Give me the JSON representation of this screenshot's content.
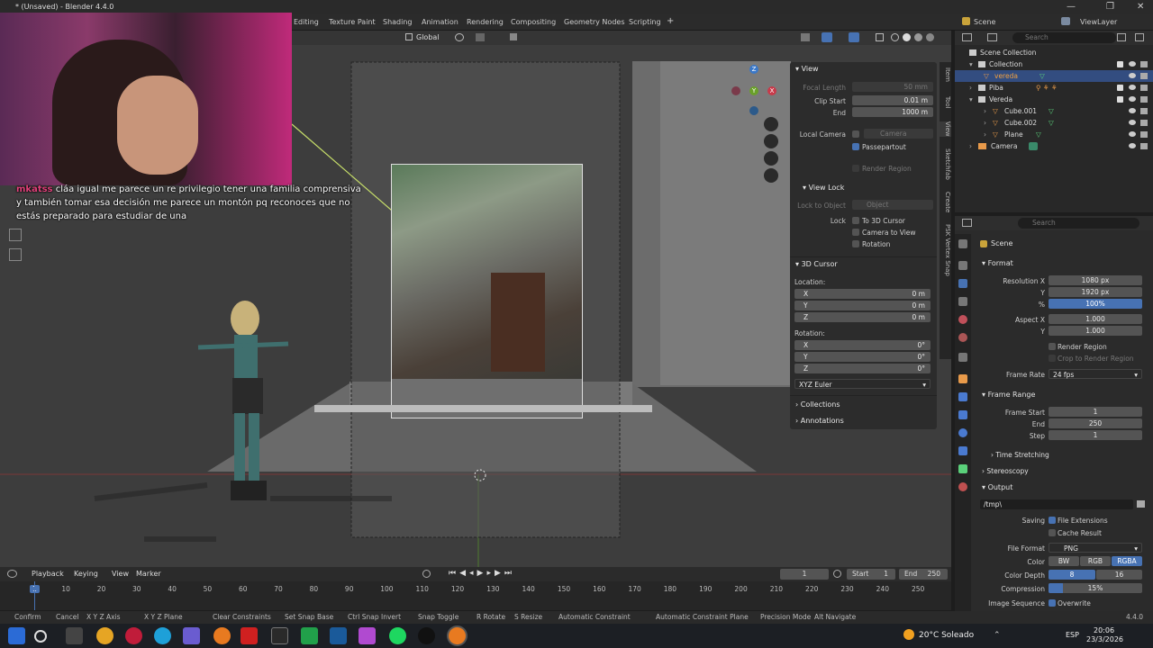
{
  "window": {
    "title": "* (Unsaved) - Blender 4.4.0",
    "min": "—",
    "max": "❐",
    "close": "✕"
  },
  "workspaces": [
    "Editing",
    "Texture Paint",
    "Shading",
    "Animation",
    "Rendering",
    "Compositing",
    "Geometry Nodes",
    "Scripting",
    "+"
  ],
  "top_right": {
    "scene": "Scene",
    "view_layer": "ViewLayer"
  },
  "viewport_header": {
    "orientation": "Global"
  },
  "chat_overlay": {
    "user": "mkatss",
    "message": "cláa igual me parece un re privilegio tener una familia comprensiva y también tomar esa decisión me parece un montón pq reconoces que no estás preparado para estudiar de una"
  },
  "gizmo": {
    "z": "Z",
    "y": "Y",
    "x": "X"
  },
  "npanel": {
    "view_header": "View",
    "focal_length_label": "Focal Length",
    "focal_length": "50 mm",
    "clip_start_label": "Clip Start",
    "clip_start": "0.01 m",
    "clip_end_label": "End",
    "clip_end": "1000 m",
    "local_camera_label": "Local Camera",
    "local_camera": "Camera",
    "passepartout": "Passepartout",
    "render_region": "Render Region",
    "view_lock_header": "View Lock",
    "lock_to_object_label": "Lock to Object",
    "lock_to_object": "Object",
    "lock_label": "Lock",
    "to_3d_cursor": "To 3D Cursor",
    "camera_to_view": "Camera to View",
    "rotation_lock": "Rotation",
    "cursor_header": "3D Cursor",
    "location_label": "Location:",
    "loc": [
      {
        "axis": "X",
        "value": "0 m"
      },
      {
        "axis": "Y",
        "value": "0 m"
      },
      {
        "axis": "Z",
        "value": "0 m"
      }
    ],
    "rotation_label": "Rotation:",
    "rot": [
      {
        "axis": "X",
        "value": "0°"
      },
      {
        "axis": "Y",
        "value": "0°"
      },
      {
        "axis": "Z",
        "value": "0°"
      }
    ],
    "rotation_mode": "XYZ Euler",
    "collections": "Collections",
    "annotations": "Annotations"
  },
  "vtabs": [
    "Item",
    "Tool",
    "View",
    "Sketchfab",
    "Create",
    "PSK Vertex Snap"
  ],
  "outliner": {
    "search_placeholder": "Search",
    "rows": [
      {
        "label": "Scene Collection"
      },
      {
        "label": "Collection"
      },
      {
        "label": "vereda"
      },
      {
        "label": "Piba"
      },
      {
        "label": "Vereda"
      },
      {
        "label": "Cube.001"
      },
      {
        "label": "Cube.002"
      },
      {
        "label": "Plane"
      },
      {
        "label": "Camera"
      }
    ]
  },
  "properties": {
    "search_placeholder": "Search",
    "scene_label": "Scene",
    "format_header": "Format",
    "res_x_label": "Resolution X",
    "res_x": "1080 px",
    "res_y_label": "Y",
    "res_y": "1920 px",
    "res_pct_label": "%",
    "res_pct": "100%",
    "aspect_x_label": "Aspect X",
    "aspect_x": "1.000",
    "aspect_y_label": "Y",
    "aspect_y": "1.000",
    "render_region": "Render Region",
    "crop": "Crop to Render Region",
    "frame_rate_label": "Frame Rate",
    "frame_rate": "24 fps",
    "frame_range_header": "Frame Range",
    "frame_start_label": "Frame Start",
    "frame_start": "1",
    "frame_end_label": "End",
    "frame_end": "250",
    "step_label": "Step",
    "step": "1",
    "time_stretching": "Time Stretching",
    "stereoscopy": "Stereoscopy",
    "output_header": "Output",
    "output_path": "/tmp\\",
    "saving_label": "Saving",
    "file_ext": "File Extensions",
    "cache_result": "Cache Result",
    "file_format_label": "File Format",
    "file_format": "PNG",
    "color_label": "Color",
    "color_opts": [
      "BW",
      "RGB",
      "RGBA"
    ],
    "color_depth_label": "Color Depth",
    "color_depth_opts": [
      "8",
      "16"
    ],
    "compression_label": "Compression",
    "compression": "15%",
    "image_sequence_label": "Image Sequence",
    "overwrite": "Overwrite"
  },
  "timeline": {
    "menus": [
      "Playback",
      "Keying",
      "View",
      "Marker"
    ],
    "current_frame": "1",
    "start_label": "Start",
    "start": "1",
    "end_label": "End",
    "end": "250",
    "ticks": [
      "1",
      "10",
      "20",
      "30",
      "40",
      "50",
      "60",
      "70",
      "80",
      "90",
      "100",
      "110",
      "120",
      "130",
      "140",
      "150",
      "160",
      "170",
      "180",
      "190",
      "200",
      "210",
      "220",
      "230",
      "240",
      "250"
    ]
  },
  "statusbar": {
    "items": [
      "Confirm",
      "Cancel",
      "X Y Z Axis",
      "X Y Z Plane",
      "Clear Constraints",
      "Set Snap Base",
      "Ctrl Snap Invert",
      "Snap Toggle",
      "R Rotate",
      "S Resize",
      "Automatic Constraint",
      "Automatic Constraint Plane",
      "Precision Mode",
      "Alt Navigate"
    ],
    "version": "4.4.0"
  },
  "taskbar": {
    "weather": "20°C Soleado",
    "lang": "ESP",
    "time": "20:06",
    "date": "23/3/2026"
  },
  "colors": {
    "accent": "#4772b3",
    "cursor_axis_red": "#a33a3a",
    "camera_line": "#c8e06a"
  }
}
